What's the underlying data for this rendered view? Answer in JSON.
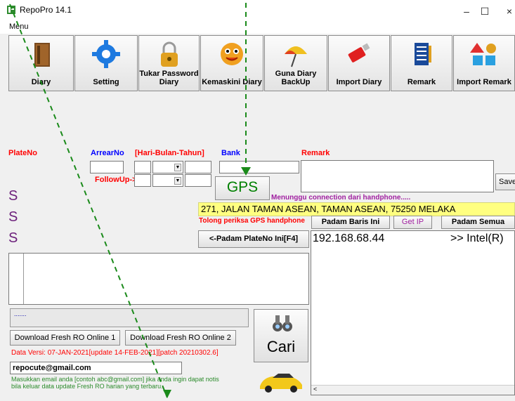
{
  "window": {
    "title": "RepoPro 14.1",
    "controls": {
      "minimize": "–",
      "maximize": "☐",
      "close": "×"
    }
  },
  "menubar": {
    "menu": "Menu"
  },
  "toolbar": [
    {
      "label": "Diary",
      "icon": "book-icon"
    },
    {
      "label": "Setting",
      "icon": "gear-icon"
    },
    {
      "label": "Tukar Password Diary",
      "icon": "padlock-icon"
    },
    {
      "label": "Kemaskini Diary",
      "icon": "smiley-icon"
    },
    {
      "label": "Guna Diary BackUp",
      "icon": "umbrella-icon"
    },
    {
      "label": "Import Diary",
      "icon": "usb-drive-icon"
    },
    {
      "label": "Remark",
      "icon": "notepad-icon"
    },
    {
      "label": "Import Remark",
      "icon": "shapes-icon"
    }
  ],
  "form": {
    "plateno_label": "PlateNo",
    "arrearno_label": "ArrearNo",
    "date_label": "[Hari-Bulan-Tahun]",
    "bank_label": "Bank",
    "remark_label": "Remark",
    "followup_label": "FollowUp->",
    "save_label": "Save",
    "gps_label": "GPS",
    "waiting_text": "Menunggu connection dari handphone.....",
    "address": "271, JALAN TAMAN ASEAN, TAMAN ASEAN, 75250 MELAKA",
    "check_gps_text": "Tolong periksa GPS handphone",
    "padam_baris_label": "Padam Baris Ini",
    "get_ip_label": "Get IP",
    "padam_semua_label": "Padam Semua",
    "padam_plateno_label": "<-Padam PlateNo Ini[F4]",
    "s_rows": [
      "S",
      "S",
      "S"
    ]
  },
  "ip_list": {
    "ip": "192.168.68.44",
    "device": ">> Intel(R)"
  },
  "status_box": {
    "text": "......."
  },
  "download": {
    "online1_label": "Download Fresh RO Online 1",
    "online2_label": "Download Fresh RO Online 2",
    "version_text": "Data Versi: 07-JAN-2021[update 14-FEB-2021][patch 20210302.6]"
  },
  "email": {
    "value": "repocute@gmail.com",
    "hint": "Masukkan email anda [contoh abc@gmail.com] jika anda ingin dapat notis bila keluar data update Fresh RO harian yang terbaru."
  },
  "search": {
    "cari_label": "Cari"
  },
  "colors": {
    "accent_green": "#008000",
    "address_bg": "#ffff80",
    "label_red": "#ff0000",
    "label_blue": "#0000ff"
  }
}
